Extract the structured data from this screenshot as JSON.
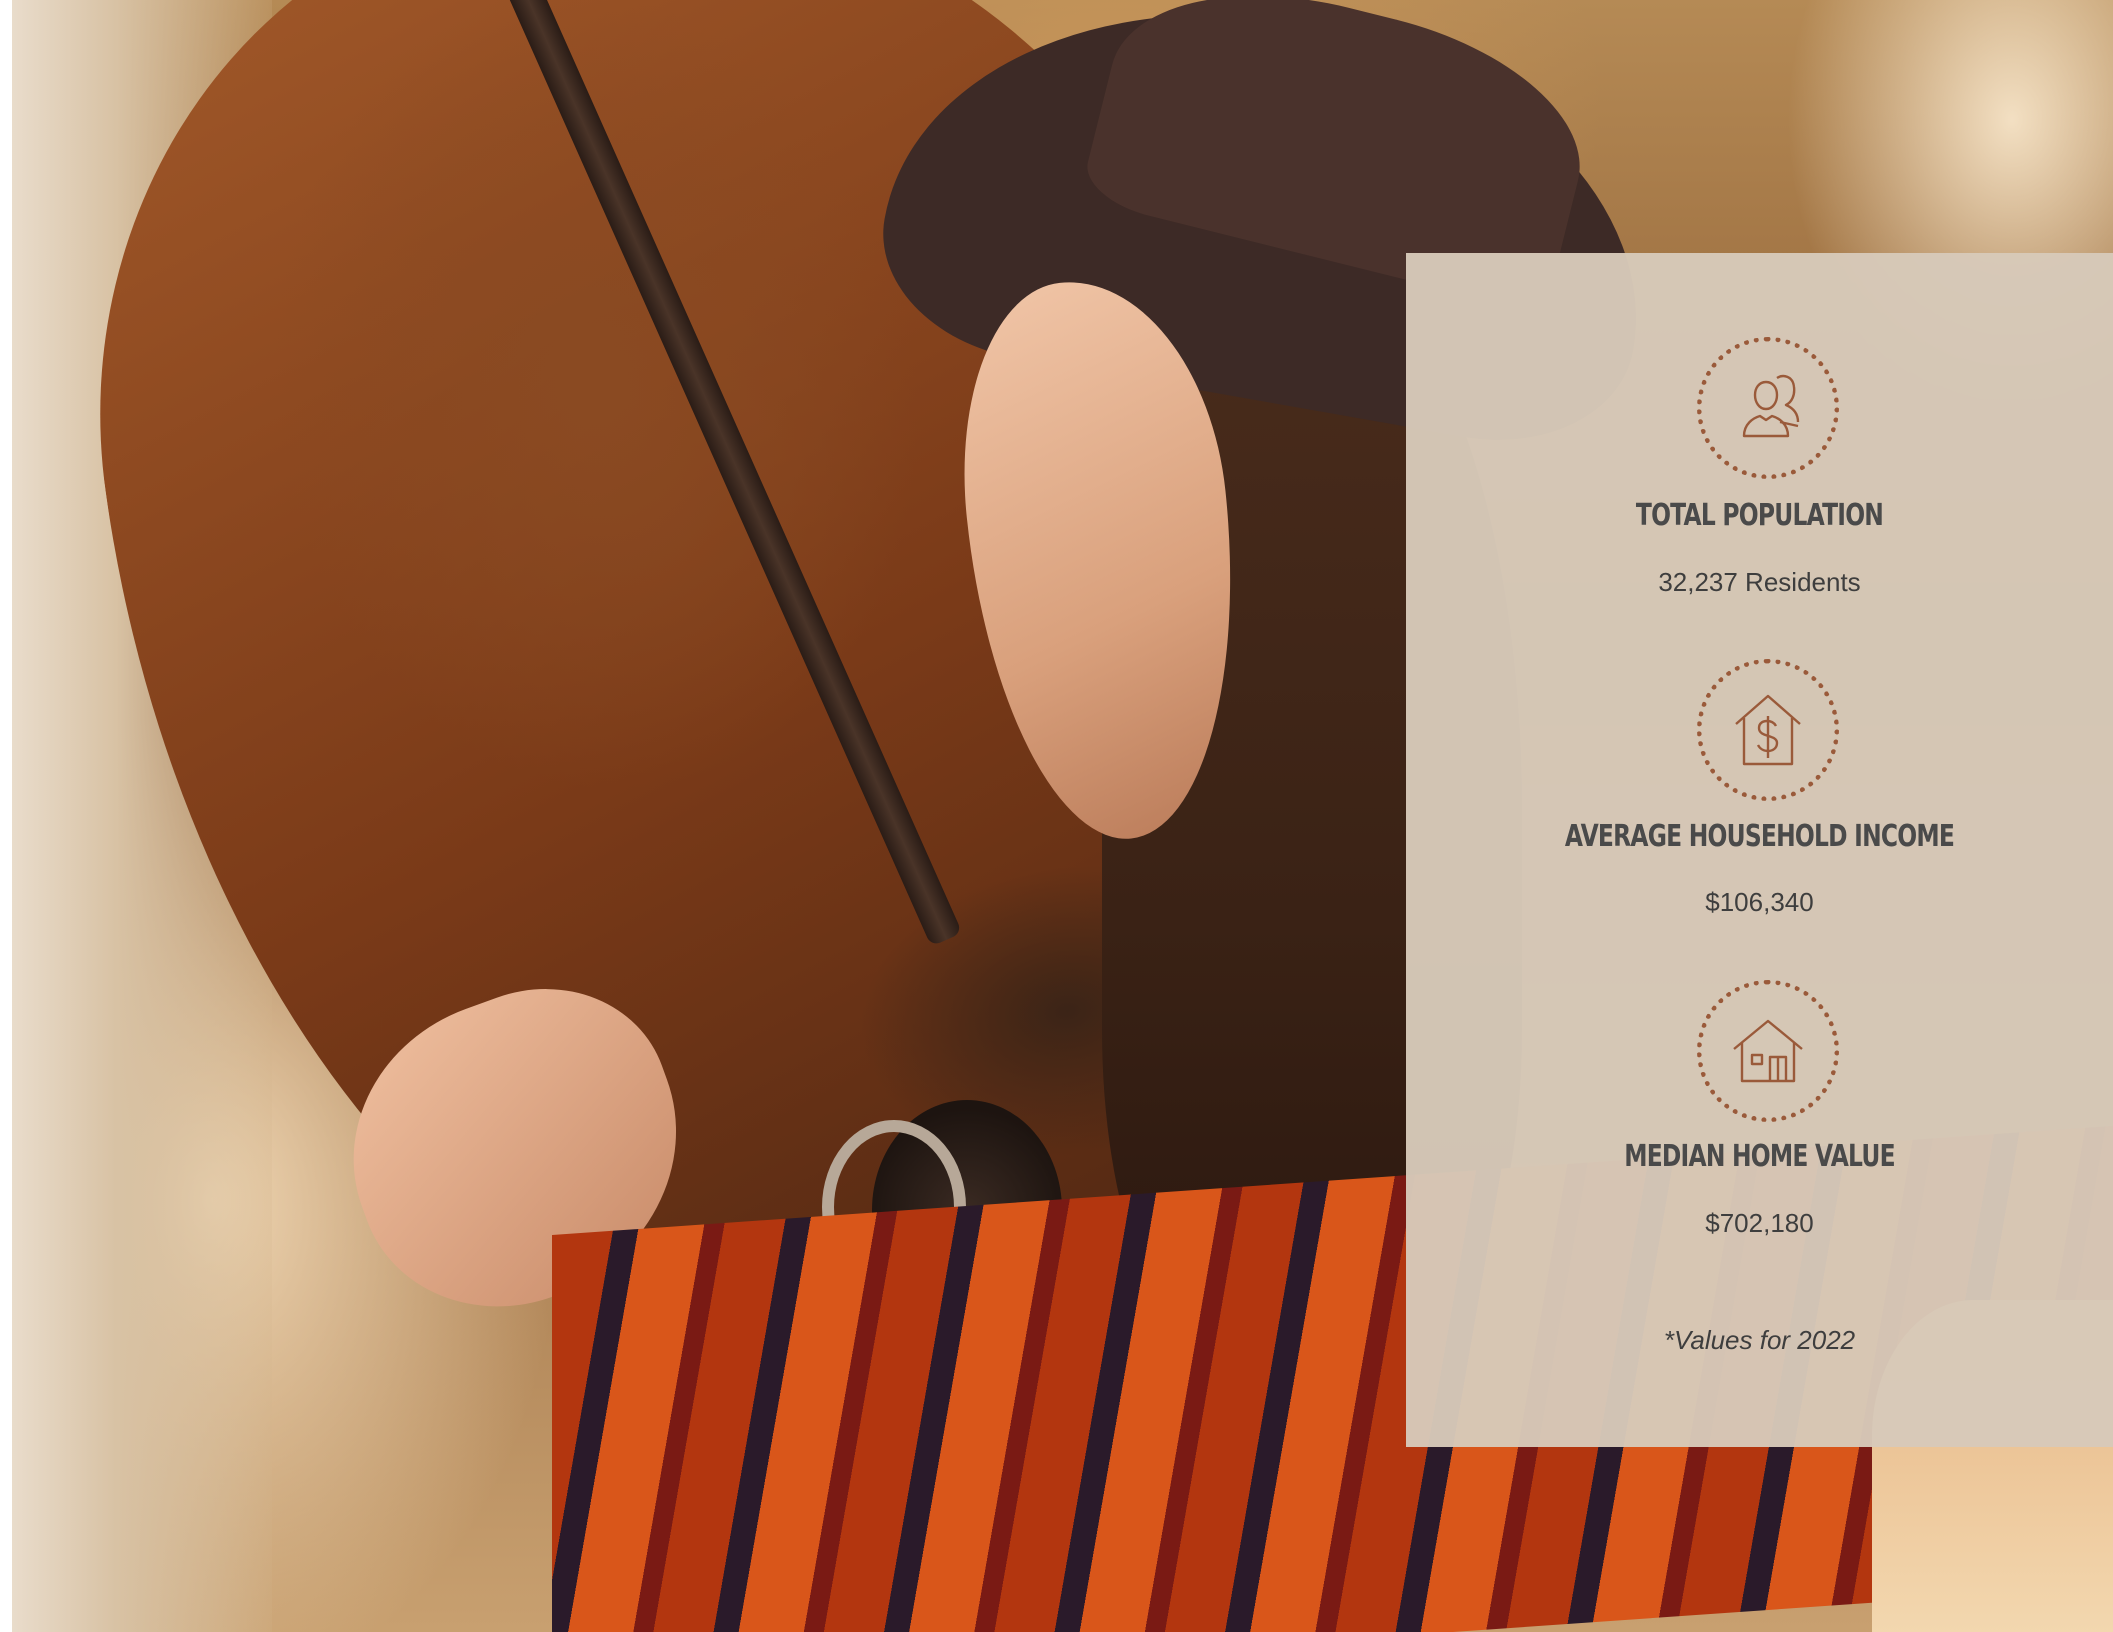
{
  "colors": {
    "panel_background": "#d7c9b9",
    "icon_accent": "#9a5a3a",
    "text": "#3e3e3e"
  },
  "stats": [
    {
      "icon": "population-icon",
      "title": "TOTAL POPULATION",
      "value": "32,237 Residents"
    },
    {
      "icon": "household-income-icon",
      "title": "AVERAGE HOUSEHOLD INCOME",
      "value": "$106,340"
    },
    {
      "icon": "home-value-icon",
      "title": "MEDIAN HOME VALUE",
      "value": "$702,180"
    }
  ],
  "footnote": "*Values for 2022"
}
